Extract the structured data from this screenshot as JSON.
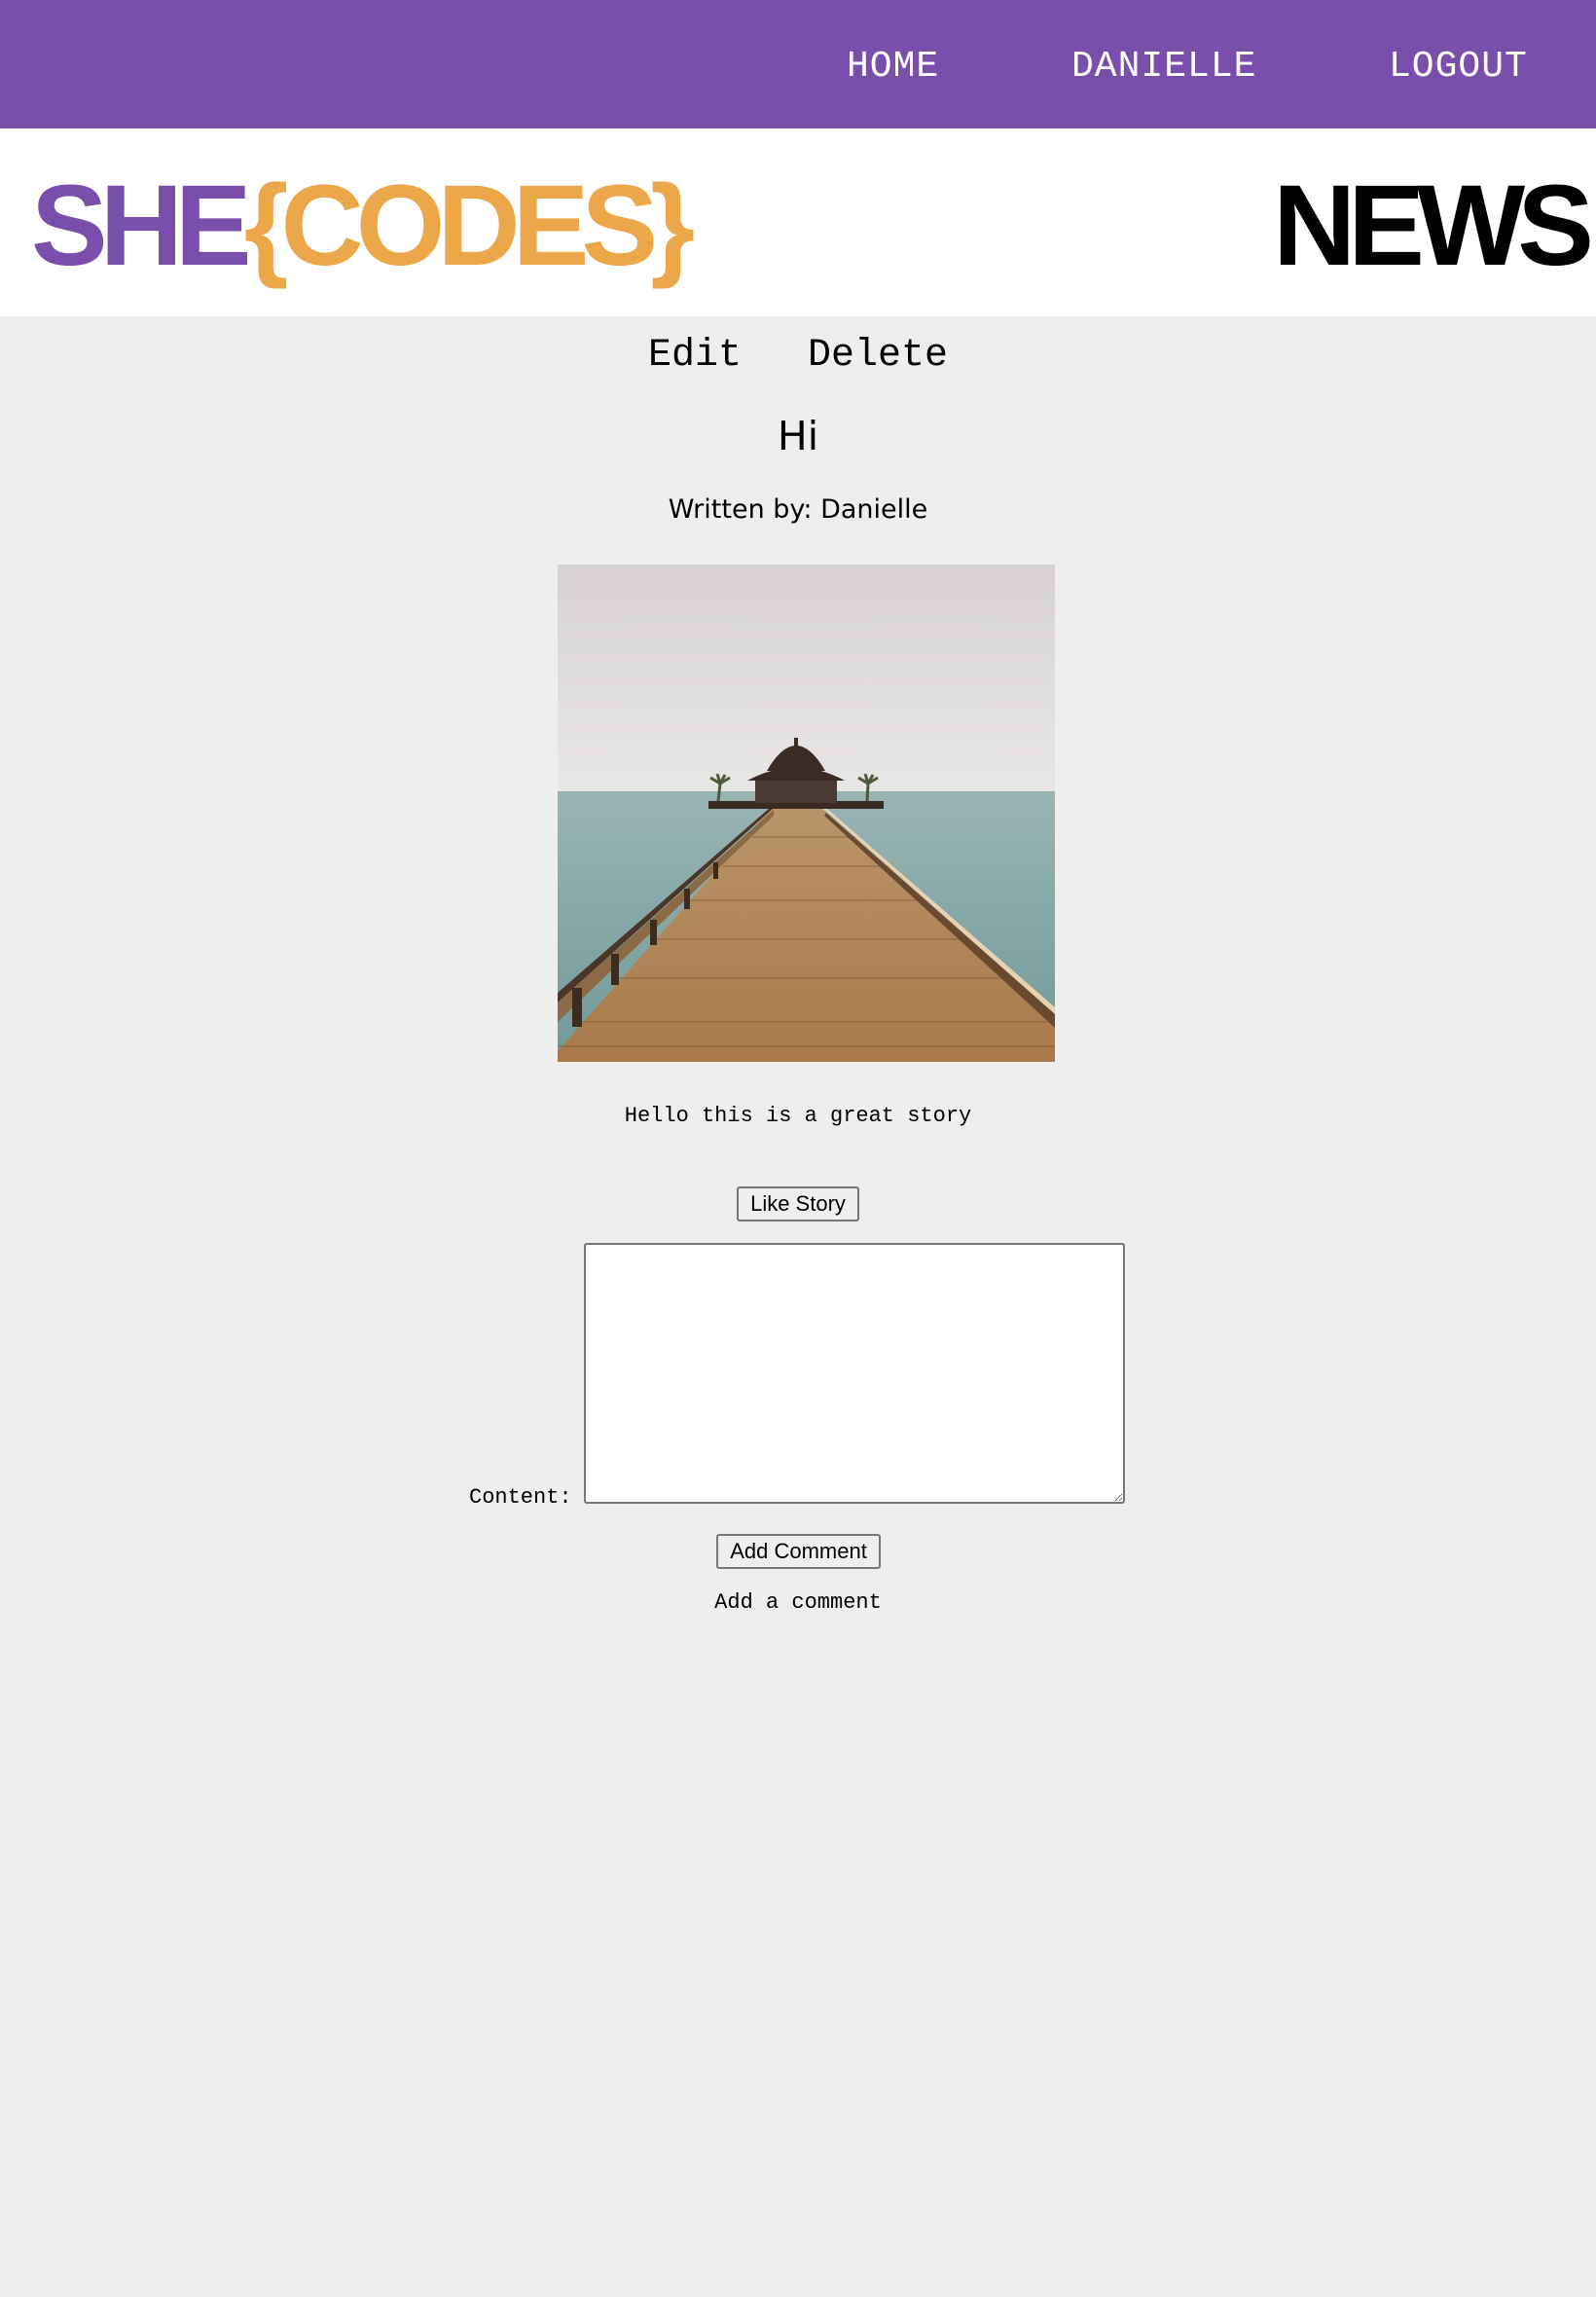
{
  "nav": {
    "home": "HOME",
    "user": "DANIELLE",
    "logout": "LOGOUT"
  },
  "brand": {
    "logo_she": "SHE",
    "logo_codes": "{CODES}",
    "news": "NEWS",
    "colors": {
      "purple": "#794fab",
      "orange": "#eca74b"
    }
  },
  "story": {
    "edit_label": "Edit",
    "delete_label": "Delete",
    "title": "Hi",
    "byline": "Written by: Danielle",
    "image_subject": "wooden-pier-photo",
    "content": "Hello this is a great story",
    "like_label": "Like Story"
  },
  "comment_form": {
    "content_label": "Content:",
    "content_value": "",
    "submit_label": "Add Comment",
    "hint": "Add a comment"
  }
}
